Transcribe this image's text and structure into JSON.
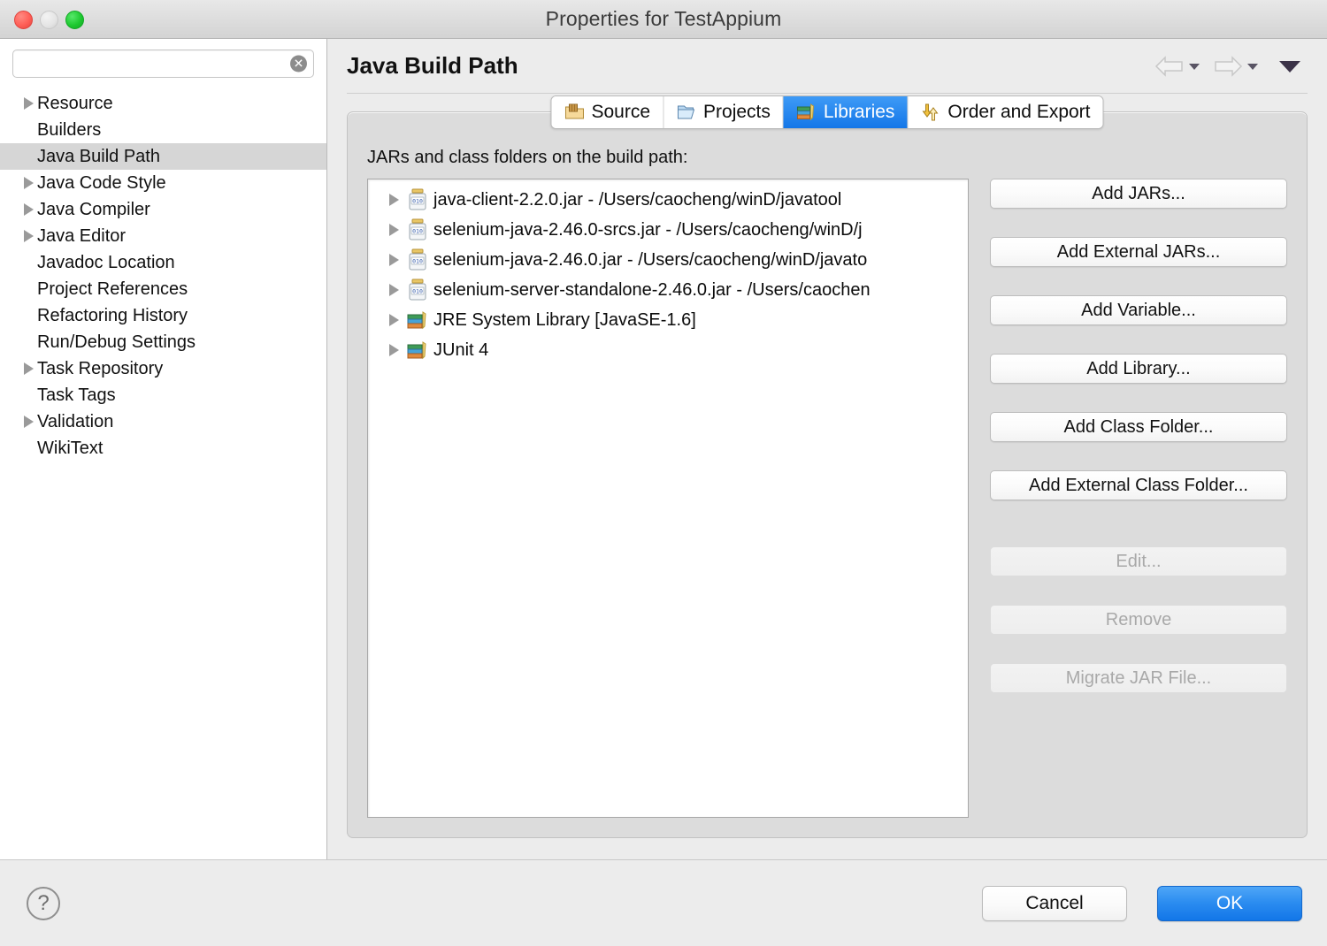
{
  "window": {
    "title": "Properties for TestAppium",
    "traffic_lights": [
      "close",
      "minimize",
      "maximize"
    ]
  },
  "sidebar": {
    "search": {
      "value": "",
      "placeholder": "",
      "clear_glyph": "✕"
    },
    "items": [
      {
        "label": "Resource",
        "expandable": true,
        "selected": false
      },
      {
        "label": "Builders",
        "expandable": false,
        "selected": false
      },
      {
        "label": "Java Build Path",
        "expandable": false,
        "selected": true
      },
      {
        "label": "Java Code Style",
        "expandable": true,
        "selected": false
      },
      {
        "label": "Java Compiler",
        "expandable": true,
        "selected": false
      },
      {
        "label": "Java Editor",
        "expandable": true,
        "selected": false
      },
      {
        "label": "Javadoc Location",
        "expandable": false,
        "selected": false
      },
      {
        "label": "Project References",
        "expandable": false,
        "selected": false
      },
      {
        "label": "Refactoring History",
        "expandable": false,
        "selected": false
      },
      {
        "label": "Run/Debug Settings",
        "expandable": false,
        "selected": false
      },
      {
        "label": "Task Repository",
        "expandable": true,
        "selected": false
      },
      {
        "label": "Task Tags",
        "expandable": false,
        "selected": false
      },
      {
        "label": "Validation",
        "expandable": true,
        "selected": false
      },
      {
        "label": "WikiText",
        "expandable": false,
        "selected": false
      }
    ]
  },
  "page": {
    "title": "Java Build Path",
    "nav": {
      "back_label": "Back",
      "forward_label": "Forward",
      "menu_label": "Show all pages"
    }
  },
  "tabs": [
    {
      "label": "Source",
      "icon": "source-folder-icon",
      "active": false
    },
    {
      "label": "Projects",
      "icon": "projects-folder-icon",
      "active": false
    },
    {
      "label": "Libraries",
      "icon": "libraries-books-icon",
      "active": true
    },
    {
      "label": "Order and Export",
      "icon": "order-export-icon",
      "active": false
    }
  ],
  "libraries": {
    "caption": "JARs and class folders on the build path:",
    "entries": [
      {
        "label": "java-client-2.2.0.jar - /Users/caocheng/winD/javatool",
        "icon": "jar-icon",
        "expandable": true
      },
      {
        "label": "selenium-java-2.46.0-srcs.jar - /Users/caocheng/winD/j",
        "icon": "jar-icon",
        "expandable": true
      },
      {
        "label": "selenium-java-2.46.0.jar - /Users/caocheng/winD/javato",
        "icon": "jar-icon",
        "expandable": true
      },
      {
        "label": "selenium-server-standalone-2.46.0.jar - /Users/caochen",
        "icon": "jar-icon",
        "expandable": true
      },
      {
        "label": "JRE System Library [JavaSE-1.6]",
        "icon": "library-icon",
        "expandable": true
      },
      {
        "label": "JUnit 4",
        "icon": "library-icon",
        "expandable": true
      }
    ]
  },
  "actions": [
    {
      "label": "Add JARs...",
      "enabled": true
    },
    {
      "label": "Add External JARs...",
      "enabled": true
    },
    {
      "label": "Add Variable...",
      "enabled": true
    },
    {
      "label": "Add Library...",
      "enabled": true
    },
    {
      "label": "Add Class Folder...",
      "enabled": true
    },
    {
      "label": "Add External Class Folder...",
      "enabled": true
    },
    {
      "label": "Edit...",
      "enabled": false
    },
    {
      "label": "Remove",
      "enabled": false
    },
    {
      "label": "Migrate JAR File...",
      "enabled": false
    }
  ],
  "footer": {
    "help_glyph": "?",
    "cancel_label": "Cancel",
    "ok_label": "OK"
  },
  "colors": {
    "accent_blue": "#1477e8",
    "ok_blue": "#2b8cf0",
    "selection_gray": "#d6d6d6",
    "window_bg": "#ececec"
  }
}
